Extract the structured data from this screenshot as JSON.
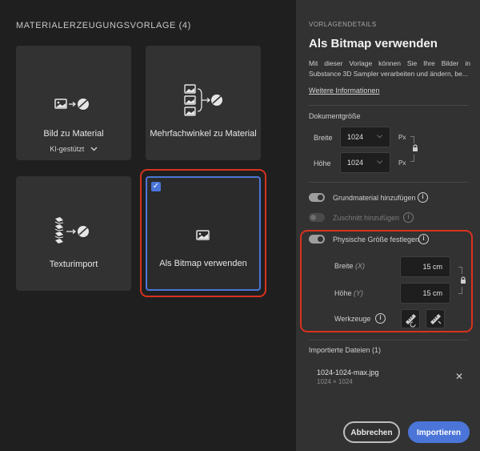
{
  "left": {
    "title": "MATERIALERZEUGUNGSVORLAGE (4)",
    "cards": [
      {
        "label": "Bild zu Material",
        "sub": "KI-gestützt"
      },
      {
        "label": "Mehrfachwinkel zu Material"
      },
      {
        "label": "Texturimport"
      },
      {
        "label": "Als Bitmap verwenden",
        "selected": true
      }
    ]
  },
  "details": {
    "overline": "VORLAGENDETAILS",
    "title": "Als Bitmap verwenden",
    "description": "Mit dieser Vorlage können Sie Ihre Bilder in Substance 3D Sampler verarbeiten und ändern, be...",
    "more_link": "Weitere Informationen",
    "document_size": {
      "label": "Dokumentgröße",
      "width_label": "Breite",
      "width_value": "1024",
      "height_label": "Höhe",
      "height_value": "1024",
      "unit": "Px"
    },
    "toggles": [
      {
        "label": "Grundmaterial hinzufügen",
        "on": true,
        "enabled": true
      },
      {
        "label": "Zuschnitt hinzufügen",
        "on": false,
        "enabled": false
      },
      {
        "label": "Physische Größe festlegen",
        "on": true,
        "enabled": true
      }
    ],
    "physical": {
      "width_label": "Breite",
      "width_axis": "(X)",
      "width_value": "15 cm",
      "height_label": "Höhe",
      "height_axis": "(Y)",
      "height_value": "15 cm",
      "tools_label": "Werkzeuge"
    },
    "imported": {
      "label": "Importierte Dateien (1)",
      "files": [
        {
          "name": "1024-1024-max.jpg",
          "size": "1024 × 1024"
        }
      ]
    }
  },
  "footer": {
    "cancel": "Abbrechen",
    "import": "Importieren"
  },
  "colors": {
    "accent": "#4b75d8",
    "highlight": "#d8321e",
    "panel": "#323232",
    "background": "#1f1f1f"
  }
}
